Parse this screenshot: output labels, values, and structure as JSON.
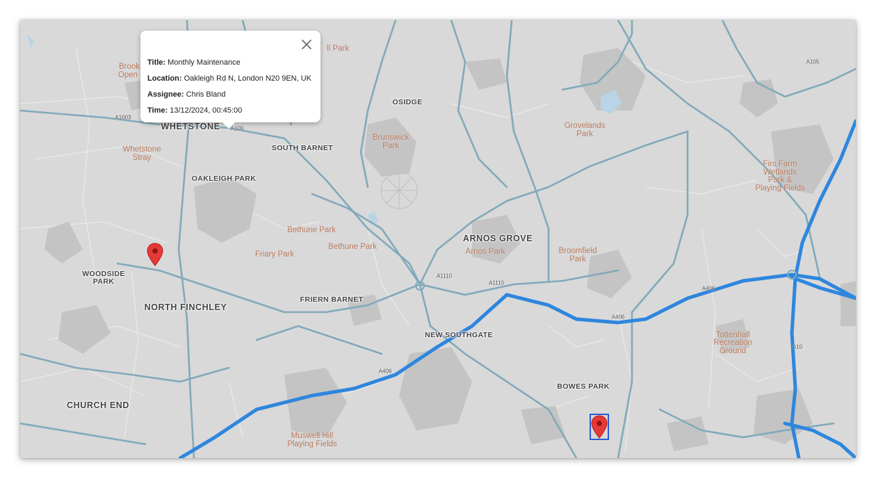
{
  "info_window": {
    "title_label": "Title:",
    "title_value": "Monthly Maintenance",
    "location_label": "Location:",
    "location_value": "Oakleigh Rd N, London N20 9EN, UK",
    "assignee_label": "Assignee:",
    "assignee_value": "Chris Bland",
    "time_label": "Time:",
    "time_value": "13/12/2024, 00:45:00",
    "close_icon": "close-icon"
  },
  "markers": [
    {
      "name": "map-marker-1",
      "icon": "map-pin-icon",
      "color": "#e53935"
    },
    {
      "name": "map-marker-2",
      "icon": "map-pin-icon",
      "color": "#e53935",
      "selected": true
    }
  ],
  "areas": {
    "whetstone": "WHETSTONE",
    "osidge": "OSIDGE",
    "south_barnet": "SOUTH BARNET",
    "oakleigh_park": "OAKLEIGH PARK",
    "arnos_grove": "ARNOS GROVE",
    "woodside_park_1": "WOODSIDE",
    "woodside_park_2": "PARK",
    "north_finchley": "NORTH FINCHLEY",
    "friern_barnet": "FRIERN BARNET",
    "new_southgate": "NEW SOUTHGATE",
    "bowes_park": "BOWES PARK",
    "church_end": "CHURCH END"
  },
  "parks": {
    "brook_1": "Brook",
    "brook_2": "Open",
    "hill_park": "ll Park",
    "brunswick_1": "Brunswick",
    "brunswick_2": "Park",
    "grovelands_1": "Grovelands",
    "grovelands_2": "Park",
    "whetstone_stray_1": "Whetstone",
    "whetstone_stray_2": "Stray",
    "firs_farm_1": "Firs Farm",
    "firs_farm_2": "Wetlands",
    "firs_farm_3": "Park &",
    "firs_farm_4": "Playing Fields",
    "bethune_1": "Bethune Park",
    "bethune_2": "Bethune Park",
    "friary": "Friary Park",
    "arnos_park": "Arnos Park",
    "broomfield_1": "Broomfield",
    "broomfield_2": "Park",
    "tottenhall_1": "Tottenhall",
    "tottenhall_2": "Recreation",
    "tottenhall_3": "Ground",
    "muswell_1": "Muswell Hill",
    "muswell_2": "Playing Fields"
  },
  "roads": {
    "a109": "A109",
    "a1110_a": "A1110",
    "a1110_b": "A1110",
    "a406_a": "A406",
    "a406_b": "A406",
    "a406_c": "A406",
    "a105": "A105",
    "a10": "A10",
    "a1003": "A1003"
  },
  "colors": {
    "map_background": "#d9d9d9",
    "motorway": "#2e86de",
    "major_road": "#7fa7b8",
    "building": "#c2c2c2",
    "park_text": "#b97b5e",
    "marker": "#e53935"
  }
}
